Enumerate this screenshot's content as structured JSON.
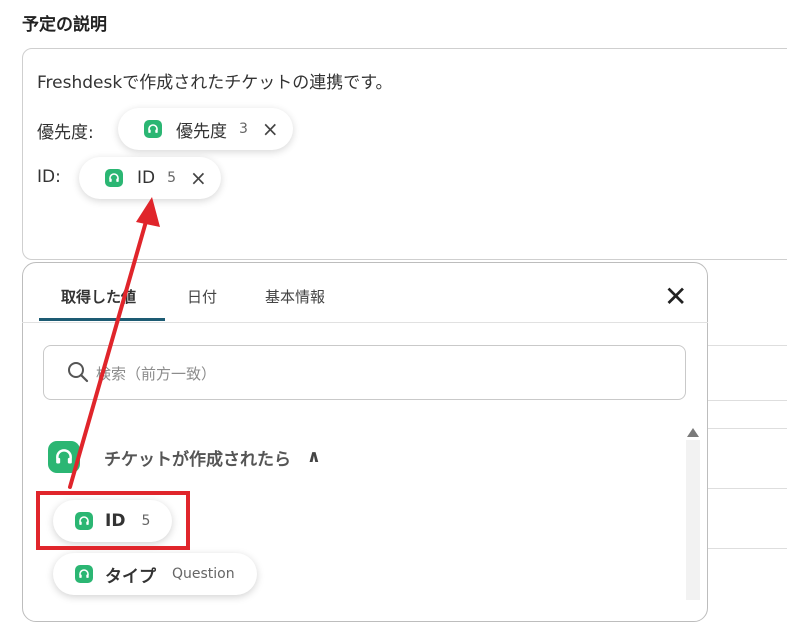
{
  "section_title": "予定の説明",
  "description": {
    "line1": "Freshdeskで作成されたチケットの連携です。",
    "fields": [
      {
        "label": "優先度:",
        "chip_name": "優先度",
        "chip_num": "3"
      },
      {
        "label": "ID:",
        "chip_name": "ID",
        "chip_num": "5"
      }
    ]
  },
  "panel": {
    "tabs": [
      "取得した値",
      "日付",
      "基本情報"
    ],
    "search_placeholder": "検索（前方一致）",
    "group_title": "チケットが作成されたら",
    "items": [
      {
        "name": "ID",
        "sub": "5"
      },
      {
        "name": "タイプ",
        "sub": "Question"
      }
    ]
  },
  "icons": {
    "chip_remove": "×",
    "panel_close": "✕",
    "chevron_up": "∧"
  },
  "colors": {
    "freshdesk_green": "#2bb673",
    "highlight_red": "#e0252b",
    "tab_underline": "#1d5b73"
  }
}
